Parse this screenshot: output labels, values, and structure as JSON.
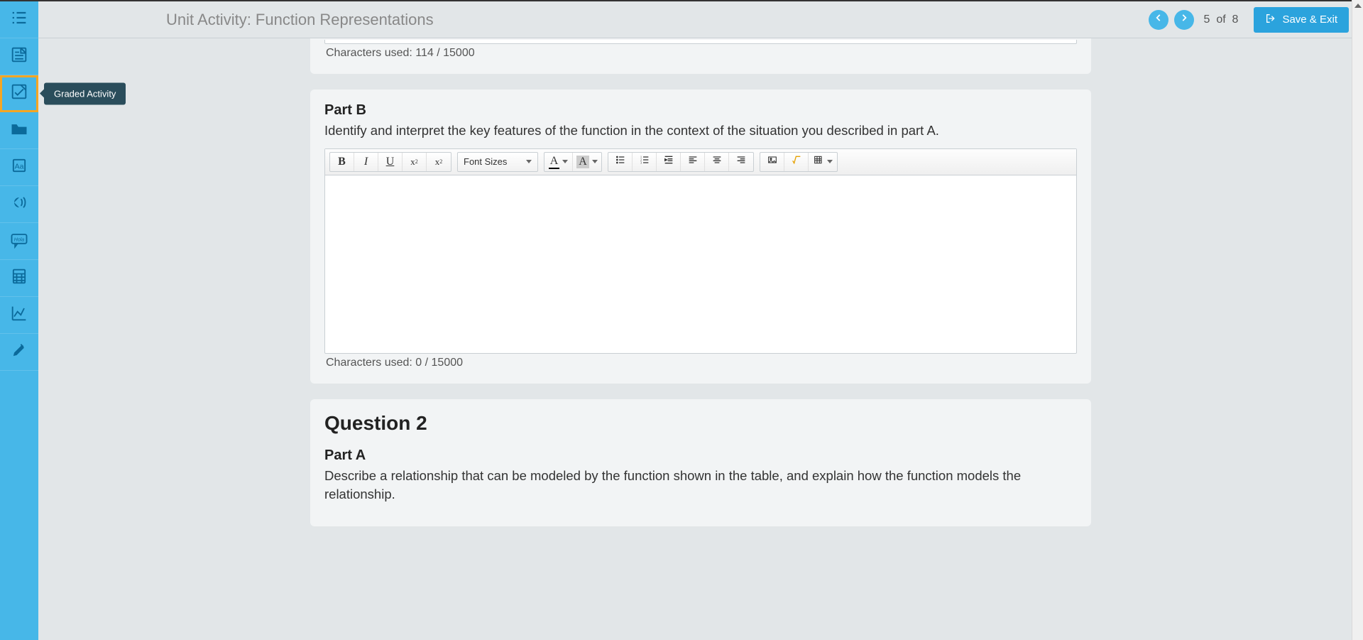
{
  "header": {
    "title": "Unit Activity: Function Representations",
    "pager": {
      "current": 5,
      "sep": "of",
      "total": 8
    },
    "save_exit_label": "Save & Exit"
  },
  "sidebar": {
    "items": [
      {
        "name": "list",
        "tooltip": ""
      },
      {
        "name": "notes",
        "tooltip": ""
      },
      {
        "name": "graded-activity",
        "tooltip": "Graded Activity",
        "selected": true
      },
      {
        "name": "folder",
        "tooltip": ""
      },
      {
        "name": "dictionary",
        "tooltip": ""
      },
      {
        "name": "audio",
        "tooltip": ""
      },
      {
        "name": "translate",
        "tooltip": ""
      },
      {
        "name": "calculator",
        "tooltip": ""
      },
      {
        "name": "graph",
        "tooltip": ""
      },
      {
        "name": "highlighter",
        "tooltip": ""
      }
    ]
  },
  "editor_toolbar": {
    "font_sizes_label": "Font Sizes"
  },
  "blocks": {
    "prev_char_count": "Characters used: 114 / 15000",
    "partB": {
      "label": "Part B",
      "prompt": "Identify and interpret the key features of the function in the context of the situation you described in part A.",
      "char_count": "Characters used: 0 / 15000"
    },
    "q2": {
      "heading": "Question 2",
      "partA": {
        "label": "Part A",
        "prompt": "Describe a relationship that can be modeled by the function shown in the table, and explain how the function models the relationship."
      }
    }
  }
}
